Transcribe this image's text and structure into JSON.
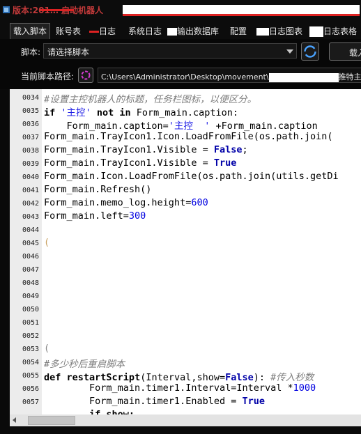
{
  "window": {
    "title": "版本:201…  启动机器人"
  },
  "tabs": [
    {
      "label": "载入脚本"
    },
    {
      "label": "账号表"
    },
    {
      "label": "日志"
    },
    {
      "label": "系统日志"
    },
    {
      "label": "输出数据库"
    },
    {
      "label": "配置"
    },
    {
      "label": "日志图表"
    },
    {
      "label": "日志表格"
    }
  ],
  "script_panel": {
    "script_label": "脚本:",
    "script_select_value": "请选择脚本",
    "load_button_label": "载入",
    "path_label": "当前脚本路径:",
    "path_prefix": "C:\\Users\\Administrator\\Desktop\\movement\\",
    "path_suffix": "推特主脚本"
  },
  "editor": {
    "lines": [
      {
        "num": "0034"
      },
      {
        "num": "0035"
      },
      {
        "num": "0036"
      },
      {
        "num": "0037"
      },
      {
        "num": "0038"
      },
      {
        "num": "0039"
      },
      {
        "num": "0040"
      },
      {
        "num": "0041"
      },
      {
        "num": "0042"
      },
      {
        "num": "0043"
      },
      {
        "num": "0044"
      },
      {
        "num": "0045"
      },
      {
        "num": "0046"
      },
      {
        "num": "0047"
      },
      {
        "num": "0048"
      },
      {
        "num": "0049"
      },
      {
        "num": "0050"
      },
      {
        "num": "0051"
      },
      {
        "num": "0052"
      },
      {
        "num": "0053"
      },
      {
        "num": "0054"
      },
      {
        "num": "0055"
      },
      {
        "num": "0056"
      },
      {
        "num": "0057"
      }
    ],
    "code": {
      "l34_comment": "#设置主控机器人的标题，任务栏图标，以便区分。",
      "l35_kw1": "if",
      "l35_str": "'主控'",
      "l35_kw2": "not in",
      "l35_rest": "Form_main.caption:",
      "l36_a": "    Form_main.caption=",
      "l36_str": "'主控  '",
      "l36_b": " +Form_main.caption",
      "l37": "Form_main.TrayIcon1.Icon.LoadFromFile(os.path.join(",
      "l38_a": "Form_main.TrayIcon1.Visible = ",
      "l38_const": "False",
      "l38_b": ";",
      "l39_a": "Form_main.TrayIcon1.Visible = ",
      "l39_const": "True",
      "l40": "Form_main.Icon.LoadFromFile(os.path.join(utils.getDi",
      "l41": "Form_main.Refresh()",
      "l42_a": "Form_main.memo_log.height=",
      "l42_num": "600",
      "l43_a": "Form_main.left=",
      "l43_num": "300",
      "l45_frag": "(",
      "l53_frag": "(",
      "l54_comment": "#多少秒后重启脚本",
      "l55_kw": "def",
      "l55_fn": "restartScript",
      "l55_a": "(Interval,show=",
      "l55_const": "False",
      "l55_b": "): ",
      "l55_comment": "#传入秒数",
      "l56_a": "        Form_main.timer1.Interval=Interval *",
      "l56_num": "1000",
      "l57_a": "        Form_main.timer1.Enabled = ",
      "l57_const": "True",
      "l58_partial": "        if show:"
    }
  },
  "colors": {
    "keyword": "#000000",
    "string": "#1e1ee6",
    "comment": "#7d7d7d",
    "constant": "#0000a8",
    "number": "#0000e0",
    "background_dark": "#0a0a0a"
  },
  "icons": [
    "app-icon",
    "chevron-down-icon",
    "refresh-icon",
    "path-picker-icon",
    "scroll-left-icon"
  ]
}
